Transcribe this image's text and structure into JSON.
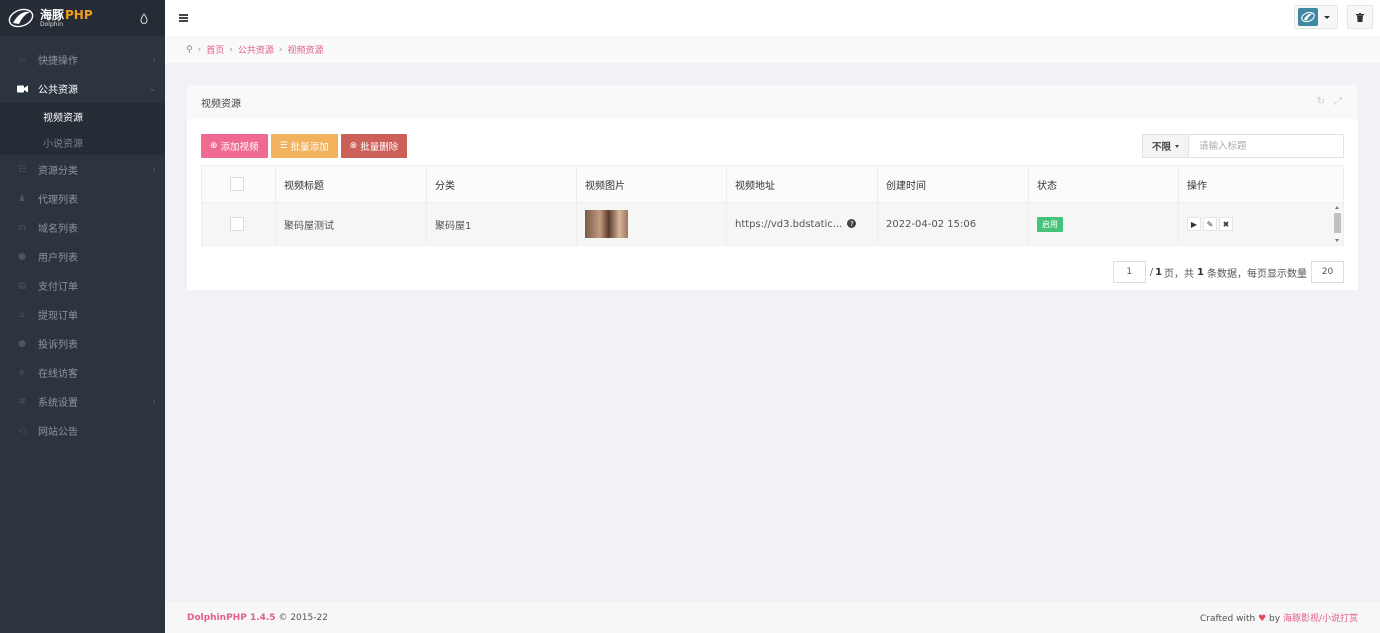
{
  "app": {
    "logo_cn": "海豚",
    "logo_php": "PHP",
    "logo_sub": "Dolphin"
  },
  "sidebar": {
    "items": [
      {
        "label": "快捷操作",
        "icon": "folder-icon",
        "has_chevron": true
      },
      {
        "label": "公共资源",
        "icon": "video-camera-icon",
        "active": true,
        "has_chevron": true
      },
      {
        "label": "资源分类",
        "icon": "list-icon",
        "has_chevron": true
      },
      {
        "label": "代理列表",
        "icon": "users-icon"
      },
      {
        "label": "域名列表",
        "icon": "linkedin-icon"
      },
      {
        "label": "用户列表",
        "icon": "user-icon"
      },
      {
        "label": "支付订单",
        "icon": "file-icon"
      },
      {
        "label": "提现订单",
        "icon": "bank-icon"
      },
      {
        "label": "投诉列表",
        "icon": "info-icon"
      },
      {
        "label": "在线访客",
        "icon": "edge-icon"
      },
      {
        "label": "系统设置",
        "icon": "gear-icon",
        "has_chevron": true
      },
      {
        "label": "网站公告",
        "icon": "bullhorn-icon"
      }
    ],
    "sub_items": [
      {
        "label": "视频资源",
        "current": true
      },
      {
        "label": "小说资源"
      }
    ]
  },
  "breadcrumb": [
    "首页",
    "公共资源",
    "视频资源"
  ],
  "panel": {
    "title": "视频资源"
  },
  "toolbar": {
    "add": "添加视频",
    "batch_add": "批量添加",
    "batch_delete": "批量删除"
  },
  "search": {
    "filter": "不限",
    "placeholder": "请输入标题"
  },
  "table": {
    "headers": [
      "视频标题",
      "分类",
      "视频图片",
      "视频地址",
      "创建时间",
      "状态",
      "操作"
    ],
    "rows": [
      {
        "title": "聚码屋测试",
        "category": "聚码屋1",
        "url": "https://vd3.bdstatic...",
        "created": "2022-04-02 15:06",
        "status": "启用"
      }
    ]
  },
  "pager": {
    "page": "1",
    "total_pages": "1",
    "total": "1",
    "per_page": "20",
    "t1": "/",
    "t2": "页，共",
    "t3": "条数据，每页显示数量"
  },
  "footer": {
    "brand": "DolphinPHP 1.4.5",
    "copy": "© 2015-22",
    "crafted": "Crafted with",
    "by": "by",
    "link": "海豚影视/小说打赏"
  },
  "colors": {
    "accent": "#e26086",
    "sidebar": "#2c343f",
    "success": "#46c37b"
  }
}
